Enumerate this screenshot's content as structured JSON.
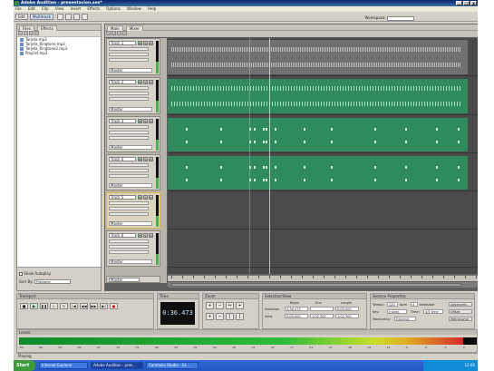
{
  "window": {
    "title": "Adobe Audition - presentacion.ses*",
    "min_label": "_",
    "max_label": "□",
    "close_label": "x"
  },
  "menu": [
    "File",
    "Edit",
    "Clip",
    "View",
    "Insert",
    "Effects",
    "Options",
    "Window",
    "Help"
  ],
  "toolbar": {
    "edit_label": "Edit",
    "multitrack_label": "Multitrack",
    "workspace_label": "Workspace:"
  },
  "files_panel": {
    "tabs": [
      "Files",
      "Effects"
    ],
    "items": [
      "Tarjeta.mp3",
      "Tarjeta_Ringtone.mp3",
      "Tarjeta_Ringtone2.mp3",
      "Playlist.mp3"
    ],
    "footer_checkbox_label": "Show Autoplay",
    "footer_sort_label": "Sort By:",
    "footer_sort_value": "Filename"
  },
  "multitrack_panel": {
    "tabs": [
      "Main",
      "Mixer"
    ]
  },
  "tracks": [
    {
      "name": "Track 1",
      "m": "M",
      "s": "S",
      "r": "R",
      "route": "Master"
    },
    {
      "name": "Track 2",
      "m": "M",
      "s": "S",
      "r": "R",
      "route": "Master"
    },
    {
      "name": "Track 3",
      "m": "M",
      "s": "S",
      "r": "R",
      "route": "Master"
    },
    {
      "name": "Track 4",
      "m": "M",
      "s": "S",
      "r": "R",
      "route": "Master"
    },
    {
      "name": "Track 5",
      "m": "M",
      "s": "S",
      "r": "R",
      "route": "Master"
    },
    {
      "name": "Track 6",
      "m": "M",
      "s": "S",
      "r": "R",
      "route": "Master"
    }
  ],
  "master_label": "Master",
  "transport": {
    "title": "Transport",
    "time_title": "Time",
    "time_display": "0:36.473",
    "zoom_title": "Zoom"
  },
  "selection_view": {
    "title": "Selection/View",
    "col_begin": "Begin",
    "col_end": "End",
    "col_length": "Length",
    "row_selection": "Selection",
    "row_view": "View",
    "sel_begin": "0:36.473",
    "sel_end": "",
    "sel_length": "0:00.000",
    "view_begin": "0:00.000",
    "view_end": "1:02.300",
    "view_length": "1:02.300"
  },
  "session": {
    "title": "Session Properties",
    "tempo_label": "Tempo:",
    "tempo_value": "120",
    "bpm_label": "bpm",
    "beats_label": "beats/bar",
    "beats_value": "4",
    "key_label": "Key:",
    "key_value": "(none)",
    "time_label": "Time:",
    "time_value": "4/4 time",
    "monitoring_label": "Monitoring:",
    "monitoring_value": "External",
    "advanced_label": "Advanced...",
    "offset_label": "Offset",
    "metronome_label": "Metronome"
  },
  "levels": {
    "title": "Levels",
    "fill_fraction": 0.97,
    "scale": [
      "-69",
      "-66",
      "-63",
      "-60",
      "-57",
      "-54",
      "-51",
      "-48",
      "-45",
      "-42",
      "-39",
      "-36",
      "-33",
      "-30",
      "-27",
      "-24",
      "-21",
      "-18",
      "-15",
      "-12",
      "-9",
      "-6",
      "-3",
      "0"
    ]
  },
  "status_text": "Playing",
  "taskbar": {
    "start_label": "Start",
    "tasks": [
      "Internet Explorer",
      "Adobe Audition - pres...",
      "Camtasia Studio - Gr..."
    ],
    "clock": "12:06"
  }
}
